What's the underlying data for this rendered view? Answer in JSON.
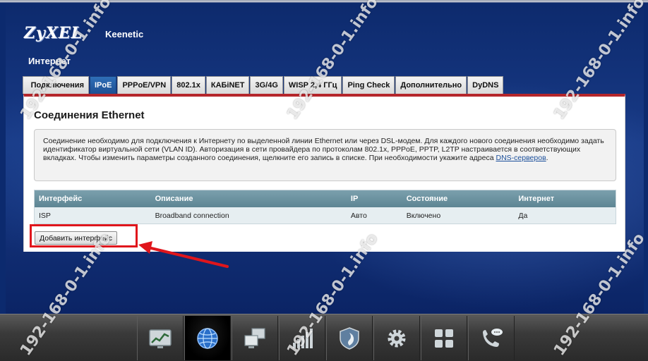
{
  "header": {
    "brand": "ZyXEL",
    "product": "Keenetic",
    "section": "Интернет"
  },
  "tabs": [
    {
      "label": "Подключения",
      "active": false
    },
    {
      "label": "IPoE",
      "active": true
    },
    {
      "label": "PPPoE/VPN",
      "active": false
    },
    {
      "label": "802.1x",
      "active": false
    },
    {
      "label": "КАБiNET",
      "active": false
    },
    {
      "label": "3G/4G",
      "active": false
    },
    {
      "label": "WISP 2,4 ГГц",
      "active": false
    },
    {
      "label": "Ping Check",
      "active": false
    },
    {
      "label": "Дополнительно",
      "active": false
    },
    {
      "label": "DyDNS",
      "active": false
    }
  ],
  "panel": {
    "title": "Соединения Ethernet",
    "info_text": "Соединение необходимо для подключения к Интернету по выделенной линии Ethernet или через DSL-модем. Для каждого нового соединения необходимо задать идентификатор виртуальной сети (VLAN ID). Авторизация в сети провайдера по протоколам 802.1x, PPPoE, PPTP, L2TP настраивается в соответствующих вкладках. Чтобы изменить параметры созданного соединения, щелкните его запись в списке. При необходимости укажите адреса ",
    "info_link": "DNS-серверов",
    "info_end": "."
  },
  "table": {
    "headers": [
      "Интерфейс",
      "Описание",
      "IP",
      "Состояние",
      "Интернет"
    ],
    "rows": [
      [
        "ISP",
        "Broadband connection",
        "Авто",
        "Включено",
        "Да"
      ]
    ]
  },
  "buttons": {
    "add_interface": "Добавить интерфейс"
  },
  "dock": {
    "items": [
      {
        "icon": "monitor-chart-icon",
        "active": false
      },
      {
        "icon": "globe-icon",
        "active": true
      },
      {
        "icon": "network-computers-icon",
        "active": false
      },
      {
        "icon": "signal-bars-icon",
        "active": false
      },
      {
        "icon": "shield-icon",
        "active": false
      },
      {
        "icon": "gear-icon",
        "active": false
      },
      {
        "icon": "apps-grid-icon",
        "active": false
      },
      {
        "icon": "phone-chat-icon",
        "active": false
      }
    ]
  },
  "watermark": "192-168-0-1.info",
  "colors": {
    "active_tab": "#1d4f93",
    "panel_accent": "#b5262b",
    "table_header": "#6a8f9c",
    "highlight": "#e0161c"
  }
}
